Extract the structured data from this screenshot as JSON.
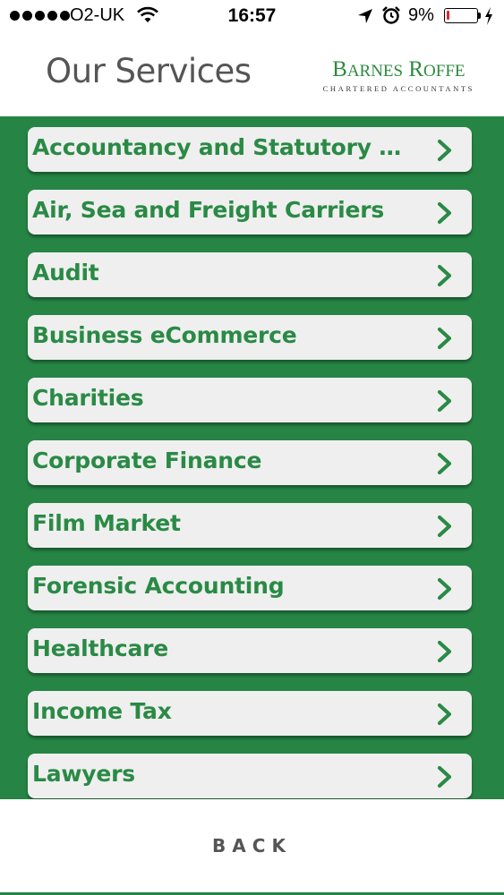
{
  "status_bar": {
    "carrier": "O2-UK",
    "time": "16:57",
    "battery_percent_label": "9%",
    "battery_level": 0.09,
    "battery_color": "#e0262a"
  },
  "header": {
    "title": "Our Services",
    "logo": {
      "name": "Barnes Roffe",
      "subtitle": "CHARTERED ACCOUNTANTS",
      "color": "#2d8a3e"
    }
  },
  "services": [
    {
      "label": "Accountancy and Statutory Ac…",
      "icon": "chevron-right-icon"
    },
    {
      "label": "Air, Sea and Freight Carriers",
      "icon": "chevron-right-icon"
    },
    {
      "label": "Audit",
      "icon": "chevron-right-icon"
    },
    {
      "label": "Business eCommerce",
      "icon": "chevron-right-icon"
    },
    {
      "label": "Charities",
      "icon": "chevron-right-icon"
    },
    {
      "label": "Corporate Finance",
      "icon": "chevron-right-icon"
    },
    {
      "label": "Film Market",
      "icon": "chevron-right-icon"
    },
    {
      "label": "Forensic Accounting",
      "icon": "chevron-right-icon"
    },
    {
      "label": "Healthcare",
      "icon": "chevron-right-icon"
    },
    {
      "label": "Income Tax",
      "icon": "chevron-right-icon"
    },
    {
      "label": "Lawyers",
      "icon": "chevron-right-icon"
    }
  ],
  "footer": {
    "back_label": "BACK"
  },
  "colors": {
    "brand_green": "#268545",
    "item_text": "#2a8a45",
    "item_bg": "#efefef"
  }
}
